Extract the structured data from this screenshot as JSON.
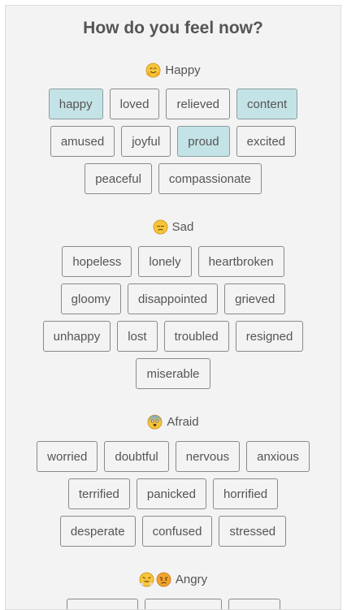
{
  "title": "How do you feel now?",
  "colors": {
    "selected_bg": "#c4e3e6",
    "chip_border": "#8a8a8a",
    "card_bg": "#f3f3f3",
    "text": "#555555"
  },
  "sections": {
    "happy": {
      "label": "Happy",
      "icon": "hugging-face-emoji",
      "chips": [
        {
          "label": "happy",
          "selected": true
        },
        {
          "label": "loved",
          "selected": false
        },
        {
          "label": "relieved",
          "selected": false
        },
        {
          "label": "content",
          "selected": true
        },
        {
          "label": "amused",
          "selected": false
        },
        {
          "label": "joyful",
          "selected": false
        },
        {
          "label": "proud",
          "selected": true
        },
        {
          "label": "excited",
          "selected": false
        },
        {
          "label": "peaceful",
          "selected": false
        },
        {
          "label": "compassionate",
          "selected": false
        }
      ]
    },
    "sad": {
      "label": "Sad",
      "icon": "pensive-face-emoji",
      "chips": [
        {
          "label": "hopeless"
        },
        {
          "label": "lonely"
        },
        {
          "label": "heartbroken"
        },
        {
          "label": "gloomy"
        },
        {
          "label": "disappointed"
        },
        {
          "label": "grieved"
        },
        {
          "label": "unhappy"
        },
        {
          "label": "lost"
        },
        {
          "label": "troubled"
        },
        {
          "label": "resigned"
        },
        {
          "label": "miserable"
        }
      ]
    },
    "afraid": {
      "label": "Afraid",
      "icon": "fearful-face-emoji",
      "chips": [
        {
          "label": "worried"
        },
        {
          "label": "doubtful"
        },
        {
          "label": "nervous"
        },
        {
          "label": "anxious"
        },
        {
          "label": "terrified"
        },
        {
          "label": "panicked"
        },
        {
          "label": "horrified"
        },
        {
          "label": "desperate"
        },
        {
          "label": "confused"
        },
        {
          "label": "stressed"
        }
      ]
    },
    "angry": {
      "label": "Angry",
      "icons": [
        "steam-face-emoji",
        "angry-face-emoji"
      ]
    }
  }
}
